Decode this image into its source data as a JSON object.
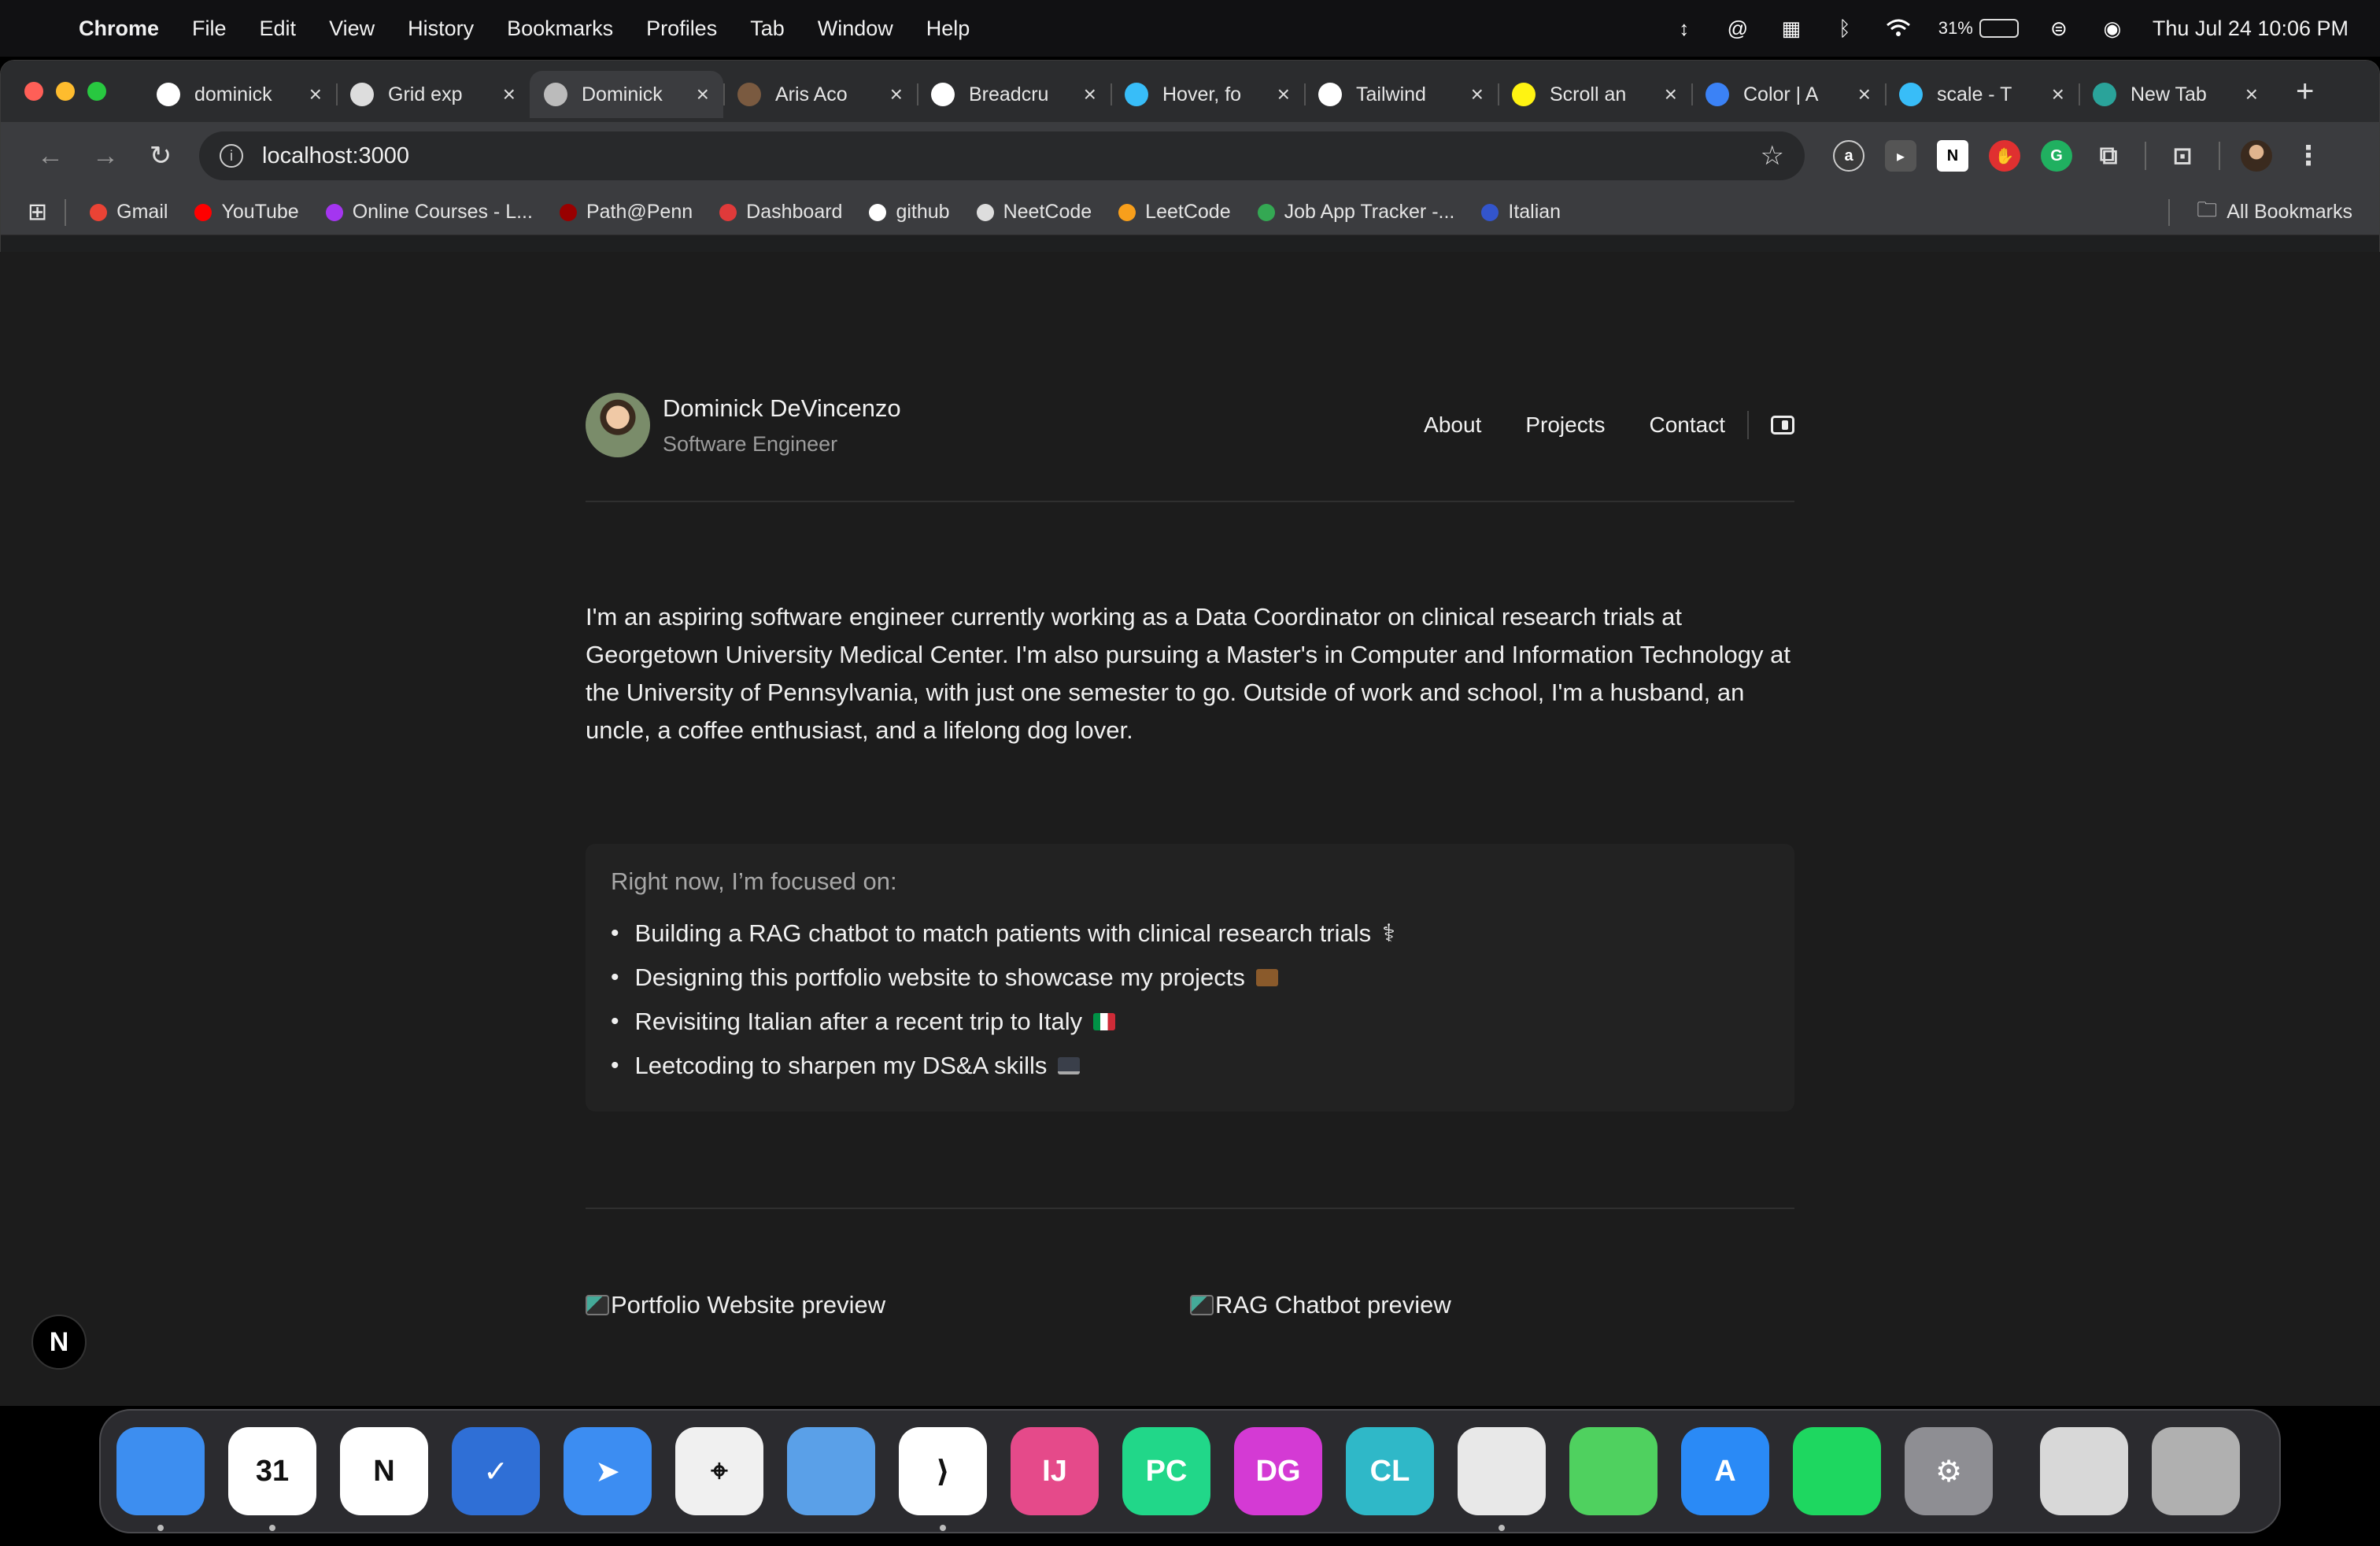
{
  "menubar": {
    "app": "Chrome",
    "items": [
      "File",
      "Edit",
      "View",
      "History",
      "Bookmarks",
      "Profiles",
      "Tab",
      "Window",
      "Help"
    ],
    "battery": "31%",
    "battery_level": 0.31,
    "datetime": "Thu Jul 24  10:06 PM"
  },
  "tabs": [
    {
      "title": "dominick",
      "favicon": "github-icon",
      "color": "#ffffff"
    },
    {
      "title": "Grid exp",
      "favicon": "openai-icon",
      "color": "#dddddd"
    },
    {
      "title": "Dominick",
      "favicon": "globe-icon",
      "color": "#bbbbbb",
      "active": true
    },
    {
      "title": "Aris Aco",
      "favicon": "avatar-icon",
      "color": "#7a5a40"
    },
    {
      "title": "Breadcru",
      "favicon": "shadcn-icon",
      "color": "#ffffff"
    },
    {
      "title": "Hover, fo",
      "favicon": "tailwind-icon",
      "color": "#38bdf8"
    },
    {
      "title": "Tailwind",
      "favicon": "shadcn-icon",
      "color": "#ffffff"
    },
    {
      "title": "Scroll an",
      "favicon": "motion-icon",
      "color": "#fff312"
    },
    {
      "title": "Color | A",
      "favicon": "color-icon",
      "color": "#3b82f6"
    },
    {
      "title": "scale - T",
      "favicon": "tailwind-icon",
      "color": "#38bdf8"
    },
    {
      "title": "New Tab",
      "favicon": "m-icon",
      "color": "#2aa39a"
    }
  ],
  "omnibox": {
    "url": "localhost:3000"
  },
  "bookmarks": [
    {
      "label": "Gmail",
      "icon": "gmail-icon",
      "color": "#ea4335"
    },
    {
      "label": "YouTube",
      "icon": "youtube-icon",
      "color": "#ff0000"
    },
    {
      "label": "Online Courses - L...",
      "icon": "udemy-icon",
      "color": "#a435f0"
    },
    {
      "label": "Path@Penn",
      "icon": "penn-icon",
      "color": "#990000"
    },
    {
      "label": "Dashboard",
      "icon": "dashboard-icon",
      "color": "#e03a3a"
    },
    {
      "label": "github",
      "icon": "github-icon",
      "color": "#ffffff"
    },
    {
      "label": "NeetCode",
      "icon": "rocket-icon",
      "color": "#dddddd"
    },
    {
      "label": "LeetCode",
      "icon": "leetcode-icon",
      "color": "#f89f1b"
    },
    {
      "label": "Job App Tracker -...",
      "icon": "sheets-icon",
      "color": "#34a853"
    },
    {
      "label": "Italian",
      "icon": "italian-icon",
      "color": "#3355cc"
    }
  ],
  "all_bookmarks": "All Bookmarks",
  "site": {
    "name": "Dominick DeVincenzo",
    "role": "Software Engineer",
    "nav": [
      "About",
      "Projects",
      "Contact"
    ],
    "bio": "I'm an aspiring software engineer currently working as a Data Coordinator on clinical research trials at Georgetown University Medical Center. I'm also pursuing a Master's in Computer and Information Technology at the University of Pennsylvania, with just one semester to go. Outside of work and school, I'm a husband, an uncle, a coffee enthusiast, and a lifelong dog lover.",
    "focus_title": "Right now, I’m focused on:",
    "focus_items": [
      {
        "text": "Building a RAG chatbot to match patients with clinical research trials",
        "emoji": "⚕"
      },
      {
        "text": "Designing this portfolio website to showcase my projects",
        "emoji": "💼"
      },
      {
        "text": "Revisiting Italian after a recent trip to Italy",
        "emoji": "🇮🇹"
      },
      {
        "text": "Leetcoding to sharpen my DS&A skills",
        "emoji": "💻"
      }
    ],
    "previews": [
      "Portfolio Website preview",
      "RAG Chatbot preview"
    ],
    "next_badge": "N"
  },
  "dock": [
    {
      "name": "finder",
      "label": "",
      "color": "#3d8ef0",
      "dot": true
    },
    {
      "name": "calendar",
      "label": "31",
      "color": "#ffffff",
      "dot": true
    },
    {
      "name": "notion",
      "label": "N",
      "color": "#ffffff",
      "dot": false
    },
    {
      "name": "tasks",
      "label": "✓",
      "color": "#2f6fd6",
      "dot": false
    },
    {
      "name": "send",
      "label": "➤",
      "color": "#3c8df2",
      "dot": false
    },
    {
      "name": "safari",
      "label": "⌖",
      "color": "#f0f0f0",
      "dot": false
    },
    {
      "name": "swift",
      "label": "",
      "color": "#5aa0e8",
      "dot": false
    },
    {
      "name": "vscode",
      "label": "⟩",
      "color": "#ffffff",
      "dot": true
    },
    {
      "name": "intellij",
      "label": "IJ",
      "color": "#e54a8a",
      "dot": false
    },
    {
      "name": "pycharm",
      "label": "PC",
      "color": "#21d789",
      "dot": false
    },
    {
      "name": "datagrip",
      "label": "DG",
      "color": "#d43ad4",
      "dot": false
    },
    {
      "name": "clion",
      "label": "CL",
      "color": "#2fb8c8",
      "dot": false
    },
    {
      "name": "chrome",
      "label": "",
      "color": "#e8e8e8",
      "dot": true
    },
    {
      "name": "messages",
      "label": "",
      "color": "#4fd15f",
      "dot": false
    },
    {
      "name": "app-store",
      "label": "A",
      "color": "#2a8af6",
      "dot": false
    },
    {
      "name": "spotify",
      "label": "",
      "color": "#1ed760",
      "dot": false
    },
    {
      "name": "system-settings",
      "label": "⚙",
      "color": "#8e8e93",
      "dot": false
    }
  ],
  "dock_right": [
    {
      "name": "downloads-stack",
      "label": "",
      "color": "#d8d8d8"
    },
    {
      "name": "trash",
      "label": "",
      "color": "#b0b0b0"
    }
  ]
}
